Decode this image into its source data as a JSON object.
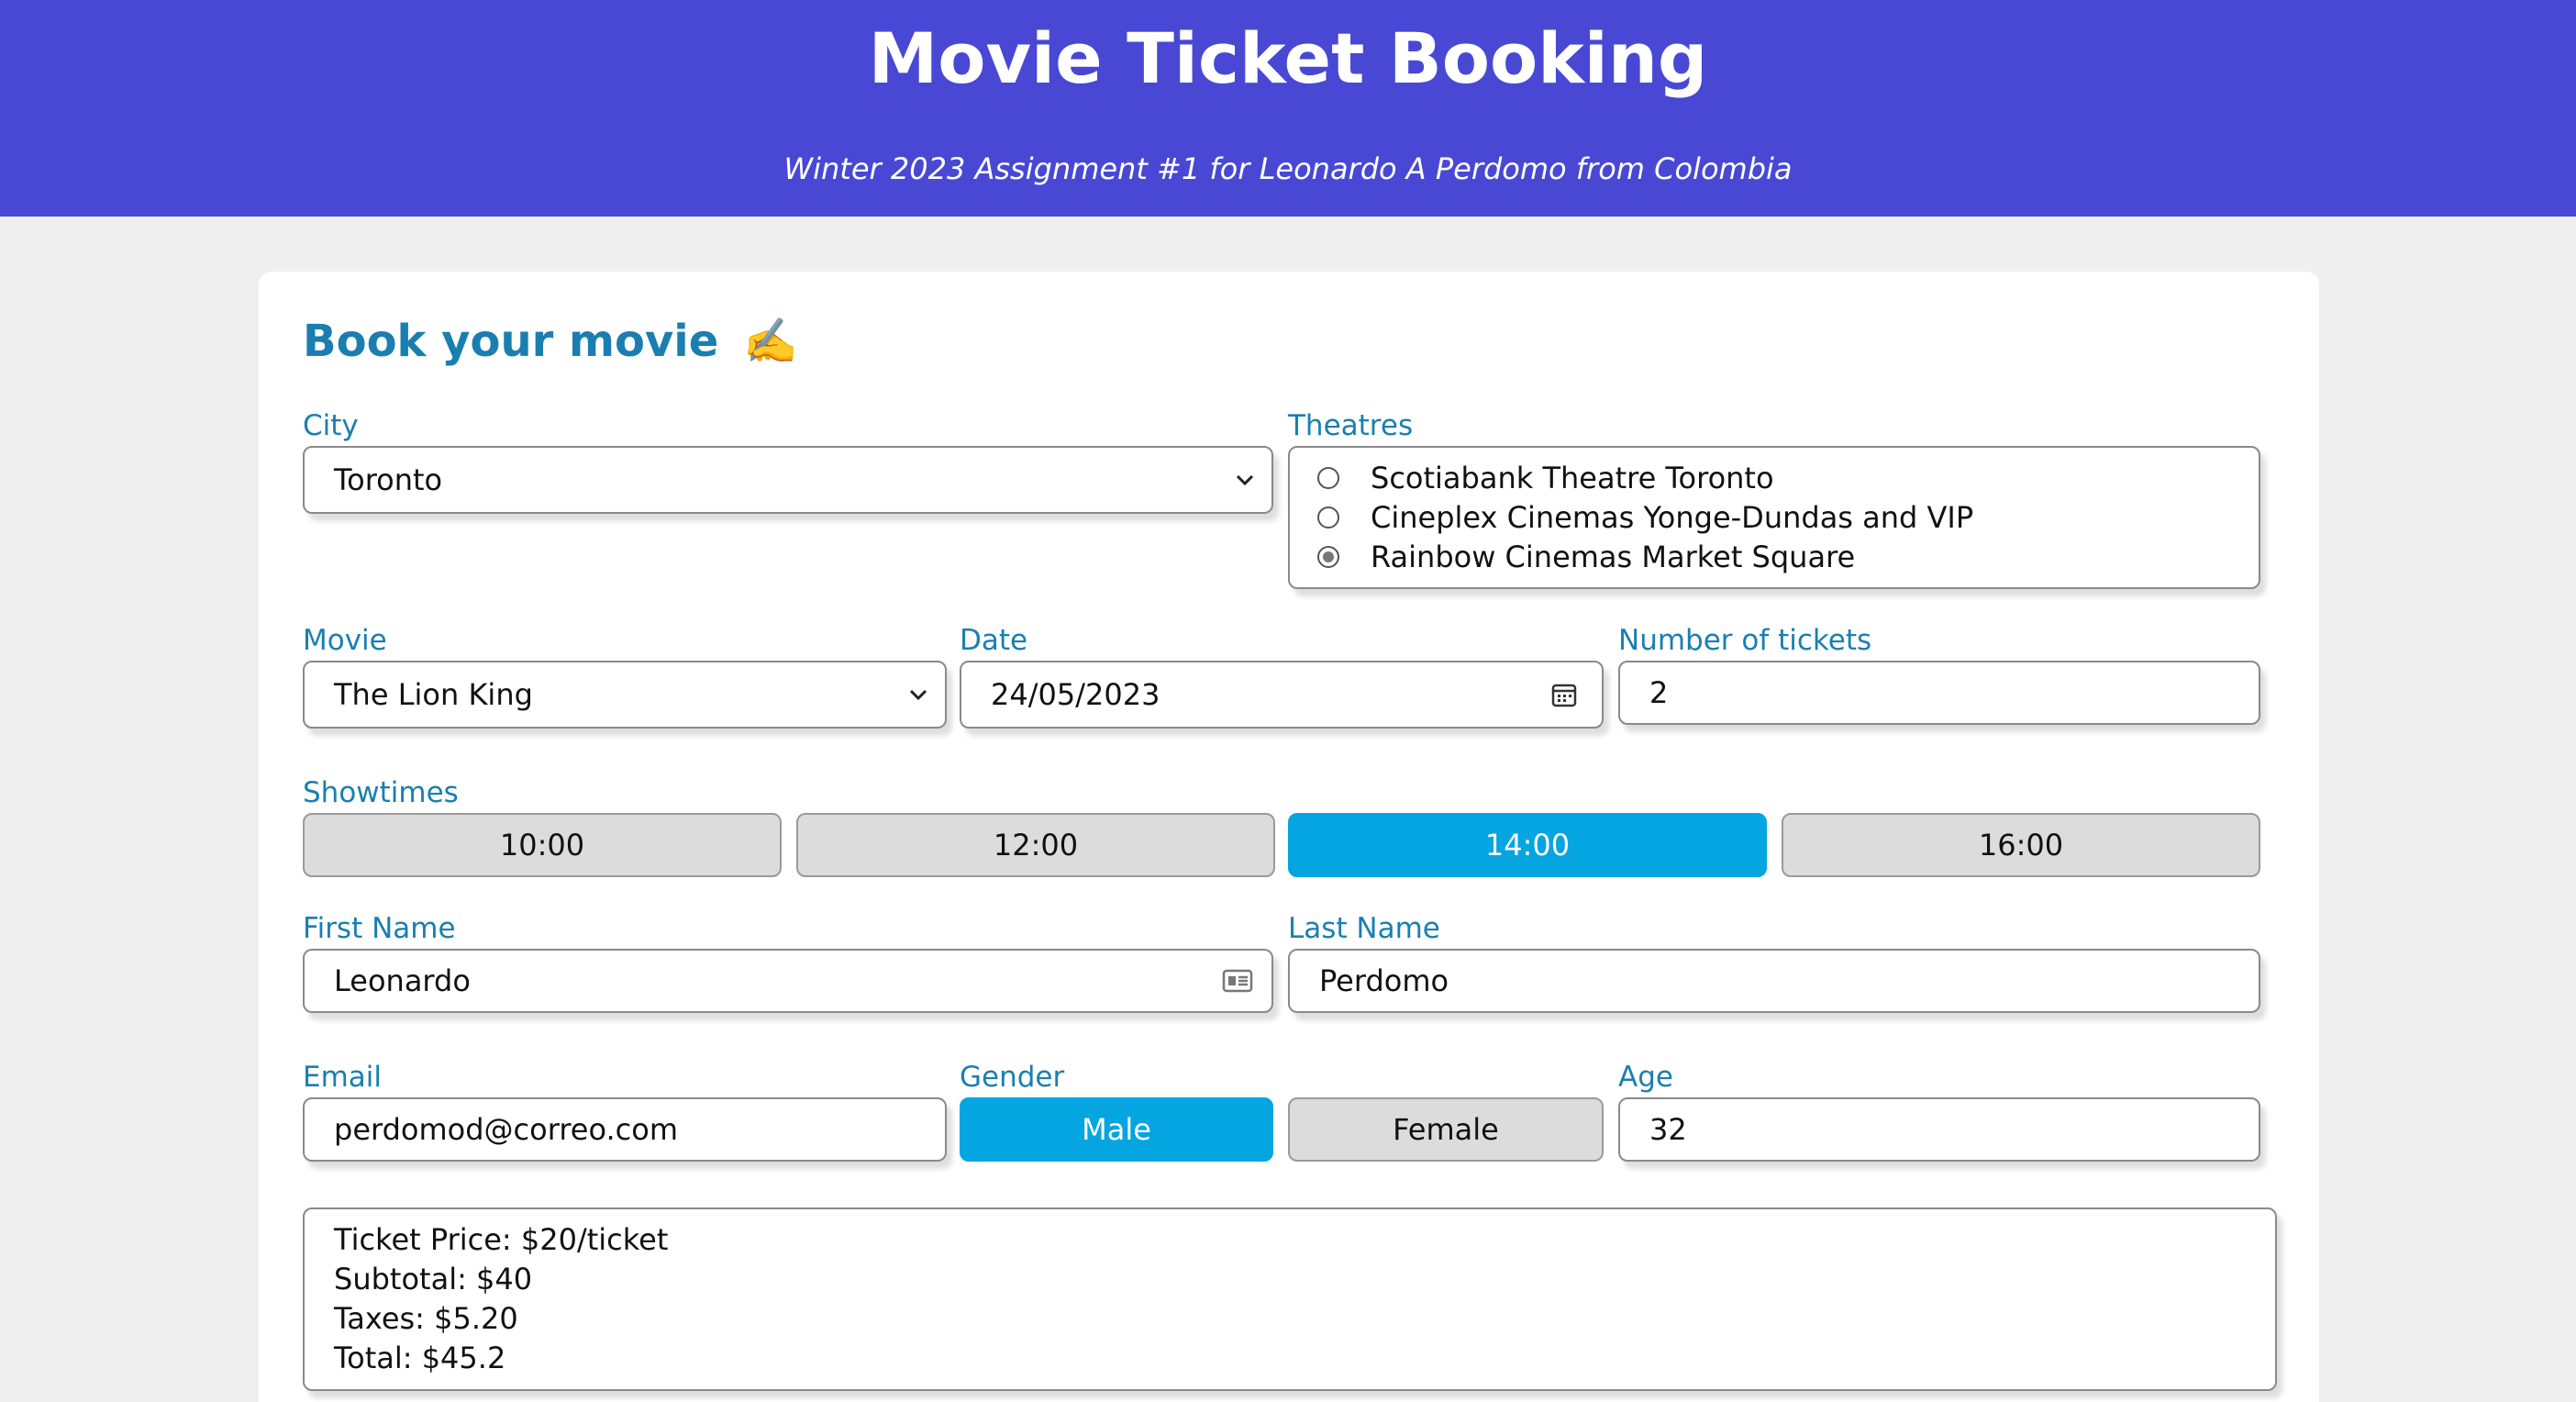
{
  "header": {
    "title": "Movie Ticket Booking",
    "subtitle": "Winter 2023 Assignment #1 for Leonardo A Perdomo from Colombia"
  },
  "form": {
    "heading": "Book your movie",
    "heading_emoji": "✍️",
    "city": {
      "label": "City",
      "value": "Toronto"
    },
    "theatres": {
      "label": "Theatres",
      "options": [
        {
          "label": "Scotiabank Theatre Toronto",
          "checked": false
        },
        {
          "label": "Cineplex Cinemas Yonge-Dundas and VIP",
          "checked": false
        },
        {
          "label": "Rainbow Cinemas Market Square",
          "checked": true
        }
      ]
    },
    "movie": {
      "label": "Movie",
      "value": "The Lion King"
    },
    "date": {
      "label": "Date",
      "value": "24/05/2023"
    },
    "tickets": {
      "label": "Number of tickets",
      "value": "2"
    },
    "showtimes": {
      "label": "Showtimes",
      "options": [
        "10:00",
        "12:00",
        "14:00",
        "16:00"
      ],
      "selected": "14:00"
    },
    "first_name": {
      "label": "First Name",
      "value": "Leonardo"
    },
    "last_name": {
      "label": "Last Name",
      "value": "Perdomo"
    },
    "email": {
      "label": "Email",
      "value": "perdomod@correo.com"
    },
    "gender": {
      "label": "Gender",
      "options": [
        "Male",
        "Female"
      ],
      "selected": "Male"
    },
    "age": {
      "label": "Age",
      "value": "32"
    }
  },
  "summary": {
    "ticket_price": "Ticket Price: $20/ticket",
    "subtotal": "Subtotal: $40",
    "taxes": "Taxes: $5.20",
    "total": "Total: $45.2"
  },
  "colors": {
    "header_bg": "#4848d4",
    "accent_label": "#1a7fb0",
    "selected_button": "#04a5e0",
    "unselected_button": "#dcdcdc"
  }
}
